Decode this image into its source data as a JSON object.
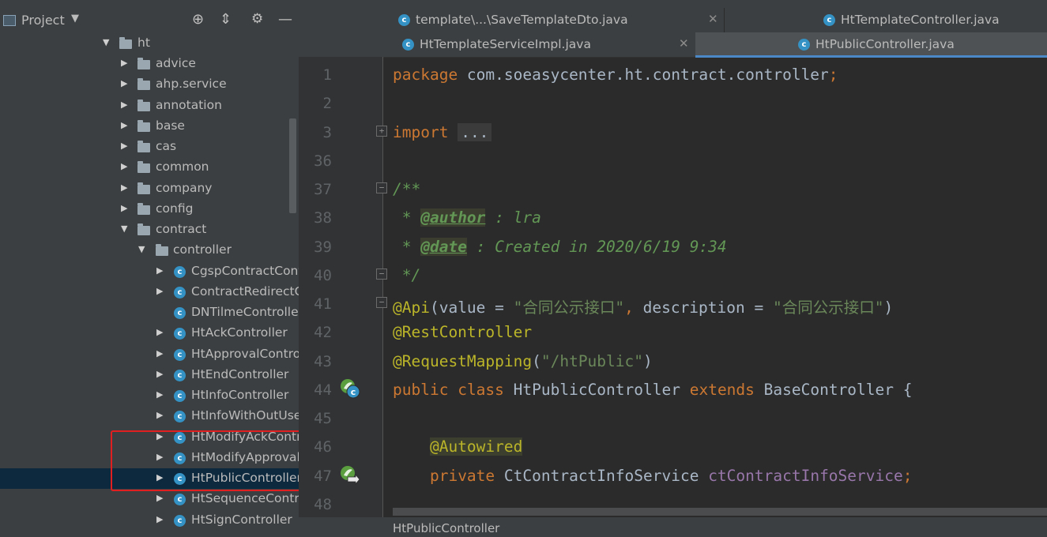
{
  "project_panel": {
    "title": "Project",
    "tree": [
      {
        "label": "ht",
        "kind": "folder"
      },
      {
        "label": "advice",
        "kind": "folder"
      },
      {
        "label": "ahp.service",
        "kind": "folder"
      },
      {
        "label": "annotation",
        "kind": "folder"
      },
      {
        "label": "base",
        "kind": "folder"
      },
      {
        "label": "cas",
        "kind": "folder"
      },
      {
        "label": "common",
        "kind": "folder"
      },
      {
        "label": "company",
        "kind": "folder"
      },
      {
        "label": "config",
        "kind": "folder"
      },
      {
        "label": "contract",
        "kind": "folder"
      },
      {
        "label": "controller",
        "kind": "folder"
      },
      {
        "label": "CgspContractCont",
        "kind": "class"
      },
      {
        "label": "ContractRedirectC",
        "kind": "class"
      },
      {
        "label": "DNTilmeController",
        "kind": "class"
      },
      {
        "label": "HtAckController",
        "kind": "class"
      },
      {
        "label": "HtApprovalContro",
        "kind": "class"
      },
      {
        "label": "HtEndController",
        "kind": "class"
      },
      {
        "label": "HtInfoController",
        "kind": "class"
      },
      {
        "label": "HtInfoWithOutUser",
        "kind": "class"
      },
      {
        "label": "HtModifyAckContr",
        "kind": "class"
      },
      {
        "label": "HtModifyApproval",
        "kind": "class"
      },
      {
        "label": "HtPublicController",
        "kind": "class"
      },
      {
        "label": "HtSequenceContro",
        "kind": "class"
      },
      {
        "label": "HtSignController",
        "kind": "class"
      }
    ]
  },
  "tabs_row1": [
    {
      "label": "template\\...\\SaveTemplateDto.java"
    },
    {
      "label": "HtTemplateController.java"
    }
  ],
  "tabs_row2": [
    {
      "label": "HtTemplateServiceImpl.java"
    },
    {
      "label": "HtPublicController.java"
    }
  ],
  "line_numbers": [
    "1",
    "2",
    "3",
    "36",
    "37",
    "38",
    "39",
    "40",
    "41",
    "42",
    "43",
    "44",
    "45",
    "46",
    "47",
    "48"
  ],
  "code": {
    "l1_kw": "package",
    "l1_text": " com.soeasycenter.ht.contract.controller",
    "l1_semi": ";",
    "l3_kw": "import",
    "l3_fold": "...",
    "l37": "/**",
    "l38_star": " * ",
    "l38_tag": "@author",
    "l38_rest": " : lra",
    "l39_star": " * ",
    "l39_tag": "@date",
    "l39_rest": " : Created in 2020/6/19 9:34",
    "l40": " */",
    "l41_ann": "@Api",
    "l41_a": "(value = ",
    "l41_s1": "\"合同公示接口\"",
    "l41_b": ", ",
    "l41_c": "description = ",
    "l41_s2": "\"合同公示接口\"",
    "l41_d": ")",
    "l42_ann": "@RestController",
    "l43_ann": "@RequestMapping",
    "l43_a": "(",
    "l43_s": "\"/htPublic\"",
    "l43_b": ")",
    "l44_kw1": "public",
    "l44_kw2": "class",
    "l44_name": " HtPublicController ",
    "l44_kw3": "extends",
    "l44_rest": " BaseController {",
    "l46_ann": "@Autowired",
    "l47_kw": "private",
    "l47_type": " CtContractInfoService ",
    "l47_fld": "ctContractInfoService",
    "l47_semi": ";"
  },
  "breadcrumb": "HtPublicController",
  "icons": {
    "tab_close": "close-icon",
    "class": "class-icon",
    "folder": "folder-icon",
    "target": "locate-icon",
    "collapse": "collapse-icon",
    "settings": "gear-icon",
    "hide": "hide-icon"
  },
  "colors": {
    "keyword": "#cc7832",
    "annotation": "#bbb529",
    "string": "#6a8759",
    "highlight_box": "#e02020",
    "tab_underline": "#4a88c7"
  }
}
